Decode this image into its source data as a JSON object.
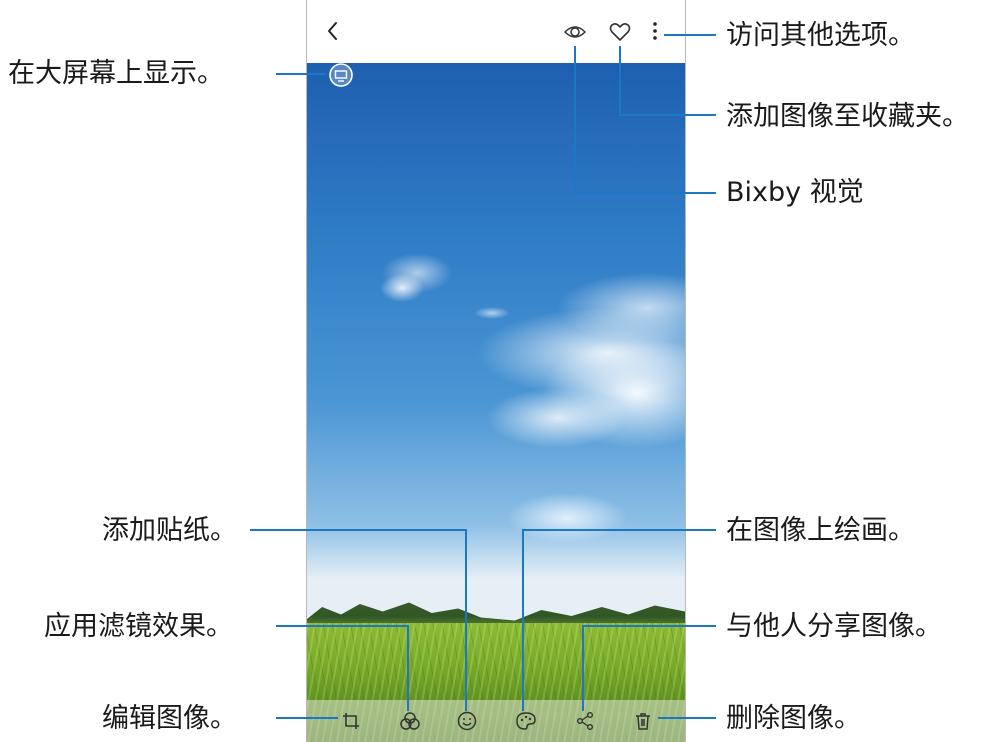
{
  "toolbar": {
    "back_icon": "chevron-left-icon",
    "bixby_icon": "bixby-vision-icon",
    "favorite_icon": "heart-outline-icon",
    "more_icon": "more-vertical-icon"
  },
  "cast_icon": "screen-mirror-icon",
  "bottom_bar": [
    "crop-icon",
    "filter-icon",
    "sticker-icon",
    "paint-icon",
    "share-icon",
    "trash-icon"
  ],
  "callouts": {
    "more_options": "访问其他选项。",
    "add_favorite": "添加图像至收藏夹。",
    "bixby_vision": "Bixby 视觉",
    "big_screen": "在大屏幕上显示。",
    "add_sticker": "添加贴纸。",
    "apply_filter": "应用滤镜效果。",
    "edit_image": "编辑图像。",
    "draw_on_image": "在图像上绘画。",
    "share_image": "与他人分享图像。",
    "delete_image": "删除图像。"
  },
  "colors": {
    "leader_line": "#1c78c4",
    "sky_top": "#1e5fb0",
    "grass": "#79ab2a"
  }
}
